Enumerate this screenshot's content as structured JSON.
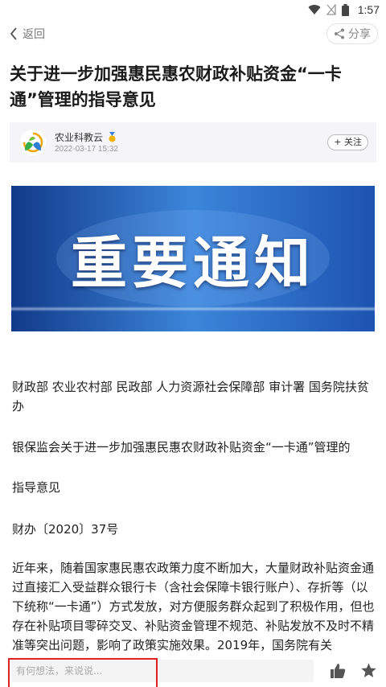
{
  "status_bar": {
    "time": "1:57"
  },
  "nav": {
    "back_label": "返回",
    "share_label": "分享"
  },
  "article": {
    "title": "关于进一步加强惠民惠农财政补贴资金“一卡通”管理的指导意见",
    "author": {
      "name": "农业科教云",
      "date": "2022-03-17 15:32",
      "follow_label": "+ 关注"
    },
    "banner_text": "重要通知",
    "paragraphs": [
      "财政部 农业农村部 民政部 人力资源社会保障部 审计署 国务院扶贫办",
      "银保监会关于进一步加强惠民惠农财政补贴资金“一卡通”管理的",
      "指导意见",
      "财办〔2020〕37号",
      "近年来，随着国家惠民惠农政策力度不断加大，大量财政补贴资金通过直接汇入受益群众银行卡（含社会保障卡银行账户）、存折等（以下统称“一卡通”）方式发放，对方便服务群众起到了积极作用，但也存在补贴项目零碎交叉、补贴资金管理不规范、补贴发放不及时不精准等突出问题，影响了政策实施效果。2019年，国务院有关"
    ]
  },
  "bottom_bar": {
    "comment_placeholder": "有何想法，来说说..."
  },
  "colors": {
    "banner_dark": "#123a8a",
    "banner_light": "#3c86da",
    "highlight": "#e02020",
    "icon_gray": "#555555"
  }
}
